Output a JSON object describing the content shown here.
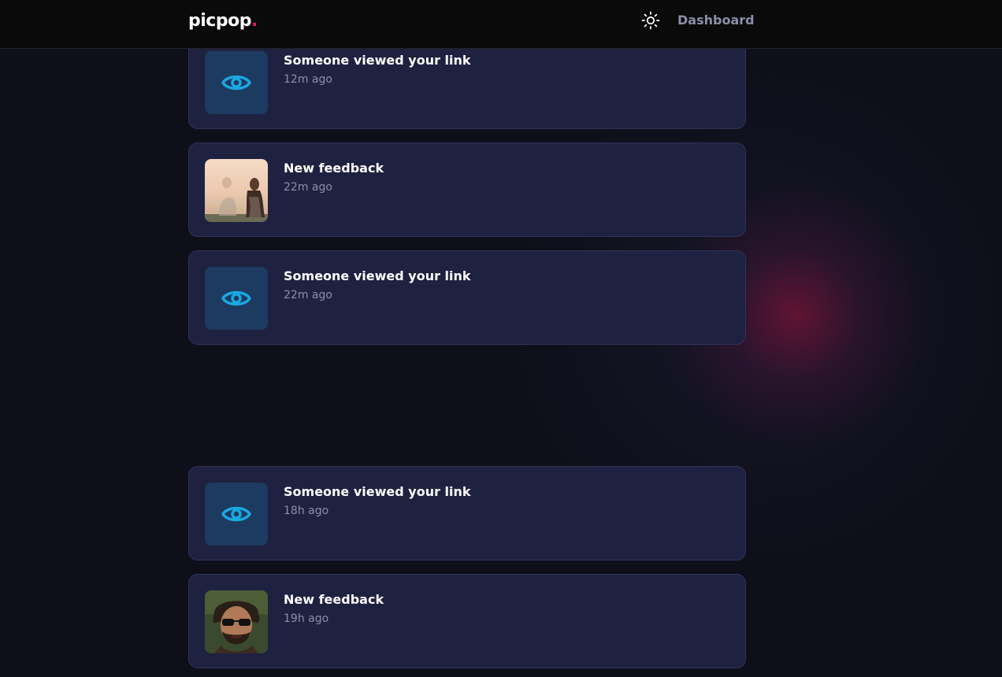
{
  "header": {
    "logo_text": "picpop",
    "logo_dot": ".",
    "theme_icon": "sun-icon",
    "nav_dashboard": "Dashboard"
  },
  "colors": {
    "background": "#0f0f1a",
    "card": "#1f2140",
    "accent_pink": "#e11d63",
    "eye_blue": "#1aa8e0"
  },
  "notifications": [
    {
      "type": "view",
      "icon": "eye-icon",
      "title": "Someone viewed your link",
      "time": "12m ago"
    },
    {
      "type": "feedback",
      "icon": "feedback-photo",
      "title": "New feedback",
      "time": "22m ago"
    },
    {
      "type": "view",
      "icon": "eye-icon",
      "title": "Someone viewed your link",
      "time": "22m ago"
    },
    {
      "type": "view",
      "icon": "eye-icon",
      "title": "Someone viewed your link",
      "time": "18h ago"
    },
    {
      "type": "feedback",
      "icon": "feedback-photo",
      "title": "New feedback",
      "time": "19h ago"
    }
  ]
}
